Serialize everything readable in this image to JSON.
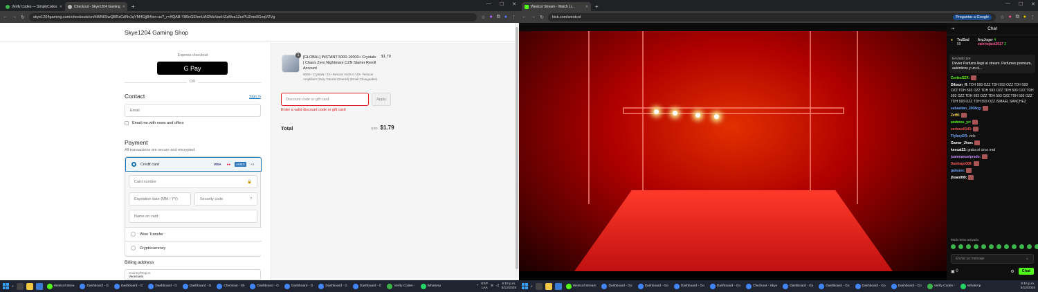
{
  "left_browser": {
    "tabs": [
      {
        "label": "Verify Codes — SimplyCodes",
        "color": "#3bb54a"
      },
      {
        "label": "Checkout - Skye1204 Gaming",
        "color": "#bbbbbb"
      }
    ],
    "url": "skye1204gaming.com/checkouts/cn/hWN6SwQBRzCdNv1qYM4GjjB4/en-us?_r=AQAB-Y80nGEhmUAI2MuVaeHZzMva1ZrzPUZmo0GeqVZVg"
  },
  "checkout": {
    "shop_name": "Skye1204 Gaming Shop",
    "express_checkout": "Express checkout",
    "gpay": "G Pay",
    "or": "OR",
    "contact": {
      "heading": "Contact",
      "sign_in": "Sign in",
      "email_placeholder": "Email",
      "newsletter": "Email me with news and offers"
    },
    "payment": {
      "heading": "Payment",
      "subtext": "All transactions are secure and encrypted.",
      "credit_card": "Credit card",
      "card_brands": [
        "VISA",
        "●●",
        "AMEX",
        "+3"
      ],
      "card_number": "Card number",
      "expiration": "Expiration date (MM / YY)",
      "security_code": "Security code",
      "name_on_card": "Name on card",
      "wise": "Wise Transfer",
      "crypto": "Cryptocurrency"
    },
    "billing": {
      "heading": "Billing address",
      "country_label": "Country/Region",
      "country_value": "Venezuela"
    }
  },
  "order": {
    "quantity": "1",
    "product_title": "[GLOBAL] INSTANT 5000-16000+ Crystals | Chaos Zero Nightmare CZN Starter Reroll Account",
    "product_desc": "5000+ Crystals / 34+ Rescue Anchor / 40+ Rescue Amplifiers (Only Tutorial Cleared) (Email Changeable)",
    "price": "$1.79",
    "discount_placeholder": "Discount code or gift card",
    "apply": "Apply",
    "error": "Enter a valid discount code or gift card",
    "total_label": "Total",
    "currency": "USD",
    "total_value": "$1.79"
  },
  "right_browser": {
    "tabs": [
      {
        "label": "Westcol Stream - Watch Li...",
        "color": "#53fc18"
      }
    ],
    "url": "kick.com/westcol",
    "translate": "Preguntar a Google"
  },
  "chat": {
    "title": "Chat",
    "leaders": [
      {
        "name": "TedSad",
        "count": "50"
      },
      {
        "name": "ArqJoger",
        "count": "4"
      },
      {
        "name": "valeriojack2017",
        "count": "3"
      }
    ],
    "pinned_by": "Enviado por",
    "pinned_text": "Dévier Parfums llegó al stream. Perfumes premium, auténticos y un ol...",
    "messages": [
      {
        "user": "CortesSZX:",
        "text": "",
        "color": "#53fc18"
      },
      {
        "user": "Dibson_ff:",
        "text": "TDH 593 OZZ TDH 593 OZZ TDH 593 OZZ TDH 593 OZZ TDH 593 OZZ TDH 593 OZZ TDH 593 OZZ TDH 593 OZZ TDH 593 OZZ TDH 593 OZZ TDH 593 OZZ TDH 593 OZZ ISMAEL SANCHEZ",
        "color": "#ffffff"
      },
      {
        "user": "sebastian_2008cg:",
        "text": "",
        "color": "#6fa8ff"
      },
      {
        "user": "Zeff0:",
        "text": "",
        "color": "#ffd84a"
      },
      {
        "user": "andreos_yz:",
        "text": "",
        "color": "#53fc18"
      },
      {
        "user": "serious0143:",
        "text": "",
        "color": "#ff5a5a"
      },
      {
        "user": "FlyboyDR:",
        "text": "velo",
        "color": "#6fa8ff"
      },
      {
        "user": "Gamer_Jhon:",
        "text": "",
        "color": "#ffffff"
      },
      {
        "user": "kevcat23:",
        "text": "graba el circo mrd",
        "color": "#ffffff"
      },
      {
        "user": "juanmanuelprado:",
        "text": "",
        "color": "#c58cff"
      },
      {
        "user": "Santiago008:",
        "text": "",
        "color": "#ff5a5a"
      },
      {
        "user": "gatsuee:",
        "text": "",
        "color": "#6fa8ff"
      },
      {
        "user": "jhoan999:",
        "text": "",
        "color": "#ffffff"
      }
    ],
    "mode": "Modo lento activado",
    "input_placeholder": "Enviar un mensaje",
    "points": "0",
    "send": "Chat"
  },
  "taskbar_left": {
    "apps": [
      "Westcol Strea",
      "Dashboard - G",
      "Dashboard - G",
      "Dashboard - G",
      "Dashboard - G",
      "Checkout - Sk",
      "Dashboard - G",
      "Dashboard - G",
      "Dashboard - G",
      "Dashboard - G",
      "Verify Codes -",
      "WhatsAp"
    ],
    "lang": "ESP",
    "lang2": "LAA",
    "time": "6:15 p.m.",
    "date": "5/12/2025"
  },
  "taskbar_right": {
    "apps": [
      "Westcol Stream",
      "Dashboard - Go",
      "Dashboard - Go",
      "Dashboard - Go",
      "Dashboard - Go",
      "Checkout - Skye",
      "Dashboard - Go",
      "Dashboard - Go",
      "Dashboard - Go",
      "Dashboard - Go",
      "Verify Codes -",
      "WhatsAp"
    ],
    "time": "6:15 p.m.",
    "date": "5/12/2025"
  }
}
